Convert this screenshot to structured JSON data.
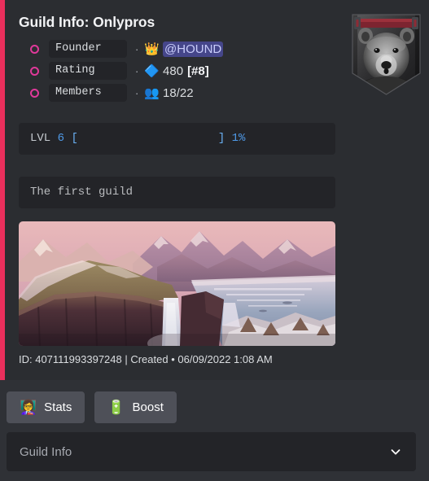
{
  "embed": {
    "accent_color": "#ea2f5c",
    "title": "Guild Info: Onlypros",
    "thumbnail": {
      "name": "guild-crest-bear",
      "alt": "Grayscale bear crest banner"
    },
    "fields": [
      {
        "bullet": "ring-bullet-icon",
        "label": "Founder",
        "separator": "·",
        "emoji": "👑",
        "emoji_name": "crown-emoji",
        "value": "@HOUND",
        "value_style": "mention"
      },
      {
        "bullet": "ring-bullet-icon",
        "label": "Rating",
        "separator": "·",
        "emoji": "🔷",
        "emoji_name": "gem-emoji",
        "value": "480",
        "value_bold": "[#8]",
        "value_style": "plain"
      },
      {
        "bullet": "ring-bullet-icon",
        "label": "Members",
        "separator": "·",
        "emoji": "👥",
        "emoji_name": "busts-in-silhouette-emoji",
        "value": "18/22",
        "value_style": "plain"
      }
    ],
    "level_block": {
      "keyword": "LVL",
      "level": "6",
      "bracket_open": "[",
      "bar_fill": "",
      "bracket_close": "]",
      "percent": "1%"
    },
    "description_block": {
      "text": "The first guild"
    },
    "image": {
      "name": "guild-banner-landscape",
      "alt": "Painted mountain landscape with waterfall at dusk"
    },
    "footer": "ID: 407111993397248 | Created • 06/09/2022 1:08 AM"
  },
  "components": {
    "buttons": [
      {
        "emoji": "👩‍🏫",
        "emoji_name": "teacher-emoji",
        "label": "Stats"
      },
      {
        "emoji": "🔋",
        "emoji_name": "battery-emoji",
        "label": "Boost"
      }
    ],
    "select": {
      "placeholder": "Guild Info",
      "icon": "chevron-down-icon"
    }
  }
}
